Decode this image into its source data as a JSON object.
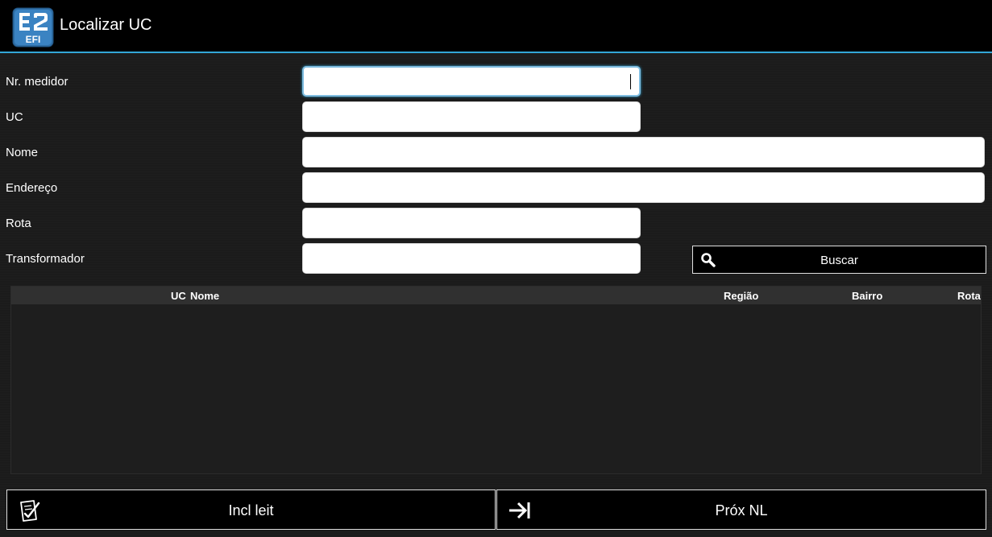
{
  "app": {
    "title": "Localizar UC",
    "icon": "e2-efi-logo-icon",
    "accent_color": "#33a6d6"
  },
  "form": {
    "fields": [
      {
        "label": "Nr. medidor",
        "value": "",
        "focused": true
      },
      {
        "label": "UC",
        "value": ""
      },
      {
        "label": "Nome",
        "value": ""
      },
      {
        "label": "Endereço",
        "value": ""
      },
      {
        "label": "Rota",
        "value": ""
      },
      {
        "label": "Transformador",
        "value": ""
      }
    ],
    "search_button": {
      "label": "Buscar",
      "icon": "magnifier-icon"
    }
  },
  "results": {
    "columns": [
      "UC",
      "Nome",
      "Região",
      "Bairro",
      "Rota"
    ],
    "rows": []
  },
  "footer": {
    "left_button": {
      "label": "Incl leit",
      "icon": "checklist-icon"
    },
    "right_button": {
      "label": "Próx NL",
      "icon": "arrow-to-bar-icon"
    }
  }
}
